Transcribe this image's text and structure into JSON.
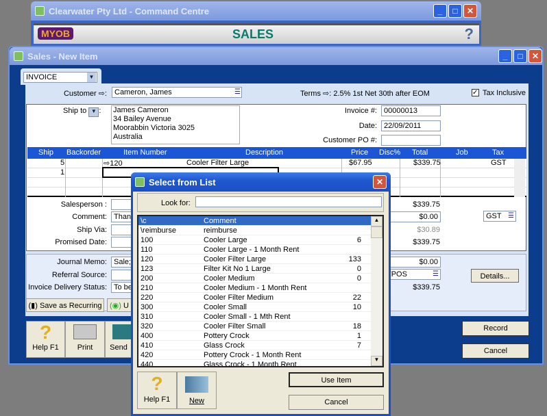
{
  "command_centre": {
    "title": "Clearwater Pty Ltd - Command Centre",
    "logo": "MYOB",
    "section": "SALES"
  },
  "sales": {
    "title": "Sales - New Item",
    "layout": "INVOICE",
    "customer_label": "Customer",
    "customer": "Cameron, James",
    "terms_label": "Terms",
    "terms": "2.5% 1st Net 30th after EOM",
    "tax_inclusive_label": "Tax Inclusive",
    "tax_inclusive": true,
    "ship_to_label": "Ship to",
    "ship_to": [
      "James Cameron",
      "34 Bailey Avenue",
      "Moorabbin  Victoria  3025",
      "Australia"
    ],
    "invoice_label": "Invoice #:",
    "invoice": "00000013",
    "date_label": "Date:",
    "date": "22/09/2011",
    "po_label": "Customer PO #:",
    "po": "",
    "columns": [
      "Ship",
      "Backorder",
      "Item Number",
      "Description",
      "Price",
      "Disc%",
      "Total",
      "Job",
      "Tax"
    ],
    "rows": [
      {
        "ship": "5",
        "item": "120",
        "description": "Cooler Filter Large",
        "price": "$67.95",
        "total": "$339.75",
        "tax": "GST"
      },
      {
        "ship": "1"
      }
    ],
    "salesperson_label": "Salesperson",
    "comment_label": "Comment:",
    "comment": "Than",
    "ship_via_label": "Ship Via:",
    "promised_label": "Promised Date:",
    "subtotal": "$339.75",
    "freight": "$0.00",
    "freight_tax": "GST",
    "tax": "$30.89",
    "total": "$339.75",
    "memo_label": "Journal Memo:",
    "memo": "Sale;",
    "referral_label": "Referral Source:",
    "delivery_label": "Invoice Delivery Status:",
    "delivery": "To be",
    "paid": "$0.00",
    "payment_method": "TPOS",
    "balance": "$339.75",
    "details": "Details...",
    "save_recurring": "Save as Recurring",
    "use_recurring": "U",
    "help": "Help F1",
    "print": "Print",
    "send": "Send",
    "record": "Record",
    "cancel": "Cancel"
  },
  "dialog": {
    "title": "Select from List",
    "look_for_label": "Look for:",
    "look_for": "",
    "items": [
      [
        "\\c",
        "Comment",
        ""
      ],
      [
        "\\reimburse",
        "reimburse",
        ""
      ],
      [
        "100",
        "Cooler Large",
        "6"
      ],
      [
        "110",
        "Cooler Large - 1 Month Rent",
        ""
      ],
      [
        "120",
        "Cooler Filter Large",
        "133"
      ],
      [
        "123",
        "Filter Kit No 1 Large",
        "0"
      ],
      [
        "200",
        "Cooler Medium",
        "0"
      ],
      [
        "210",
        "Cooler Medium - 1 Month Rent",
        ""
      ],
      [
        "220",
        "Cooler Filter Medium",
        "22"
      ],
      [
        "300",
        "Cooler Small",
        "10"
      ],
      [
        "310",
        "Cooler Small - 1 Mth Rent",
        ""
      ],
      [
        "320",
        "Cooler Filter Small",
        "18"
      ],
      [
        "400",
        "Pottery Crock",
        "1"
      ],
      [
        "410",
        "Glass Crock",
        "7"
      ],
      [
        "420",
        "Pottery Crock -  1 Month Rent",
        ""
      ],
      [
        "440",
        "Glass Crock - 1 Month Rent",
        ""
      ]
    ],
    "help": "Help F1",
    "new": "New",
    "use_item": "Use Item",
    "cancel": "Cancel"
  },
  "colors": {
    "titlebar": "#2058d0",
    "selection": "#316ac5",
    "panel": "#d6e4f5",
    "frame": "#0c3d8c"
  }
}
